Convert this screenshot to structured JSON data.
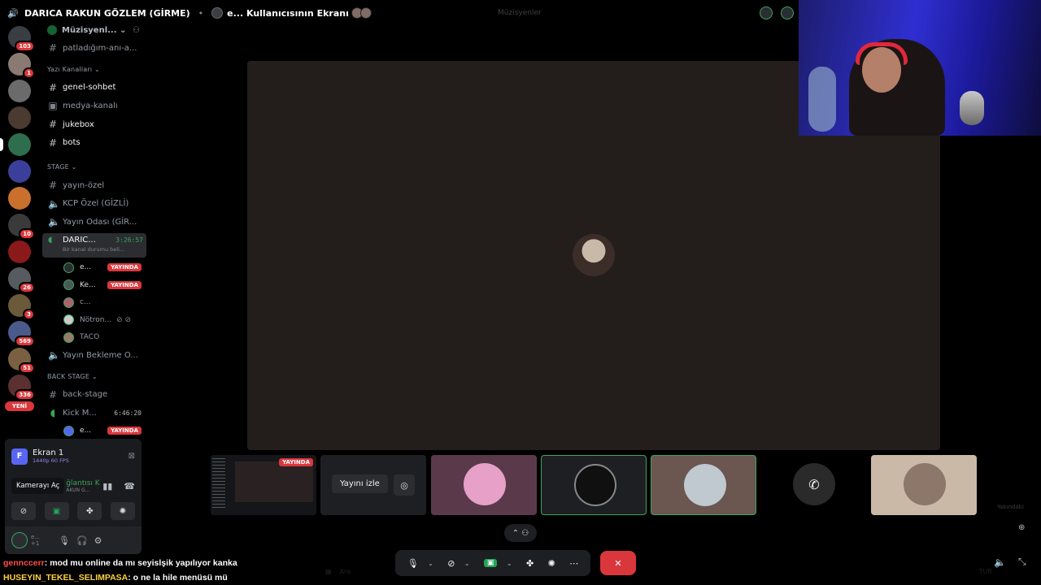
{
  "topbar": {
    "channel_title": "DARICA RAKUN GÖZLEM (GİRME)",
    "stream_title": "e... Kullanıcısının Ekranı",
    "ghost_label": "Müzisyenler"
  },
  "rail": {
    "servers": [
      {
        "badge": "103",
        "color": "#3a3d42"
      },
      {
        "badge": "1",
        "color": "#8a7a72"
      },
      {
        "badge": "",
        "color": "#6b6b6b"
      },
      {
        "badge": "",
        "color": "#4a3a30"
      },
      {
        "badge": "",
        "color": "#2e6e4e",
        "selected": true
      },
      {
        "badge": "",
        "color": "#3b3f99"
      },
      {
        "badge": "",
        "color": "#c9702c"
      },
      {
        "badge": "10",
        "color": "#3a3a3a"
      },
      {
        "badge": "",
        "color": "#8a1a1a"
      },
      {
        "badge": "26",
        "color": "#555b5f"
      },
      {
        "badge": "3",
        "color": "#6a5a3a"
      },
      {
        "badge": "569",
        "color": "#4a5a8a"
      },
      {
        "badge": "51",
        "color": "#7a6040"
      },
      {
        "badge": "336",
        "color": "#5a3030"
      }
    ],
    "new_label": "YENİ"
  },
  "channels": {
    "server_name": "Müzisyenl...",
    "top_channel": "patladığım-anı-a...",
    "cat_text": "Yazı Kanalları",
    "text_channels": [
      "genel-sohbet",
      "medya-kanalı",
      "jukebox",
      "bots"
    ],
    "cat_stage": "STAGE",
    "stage_channels": [
      "yayın-özel",
      "KCP Özel (GİZLİ)",
      "Yayın Odası (GİR..."
    ],
    "active_voice": {
      "name": "DARIC...",
      "time": "3:26:57",
      "status": "Bir kanal durumu beli..."
    },
    "members": [
      {
        "name": "e...",
        "live": "YAYINDA",
        "color": "#2a2d31"
      },
      {
        "name": "Ke...",
        "live": "YAYINDA",
        "color": "#4a5a5a"
      },
      {
        "name": "c...",
        "live": "",
        "color": "#b06070"
      },
      {
        "name": "Nötron...",
        "live": "",
        "color": "#cccccc",
        "muted": true
      },
      {
        "name": "TACO",
        "live": "",
        "color": "#9a7a6a"
      }
    ],
    "waiting_channel": "Yayın Bekleme O...",
    "cat_back": "BACK STAGE",
    "back_channel": "back-stage",
    "kick_channel": {
      "name": "Kick M...",
      "time": "6:46:20"
    },
    "kick_member": {
      "name": "e...",
      "live": "YAYINDA"
    }
  },
  "panel": {
    "screen_name": "Ekran 1",
    "screen_quality": "1440p 60 FPS",
    "tooltip": "Kamerayı Aç",
    "conn_status": "ğlantısı K",
    "conn_sub": "AKUN G...",
    "user_name": "e...",
    "user_sub": "+1"
  },
  "strip": {
    "live_label": "YAYINDA",
    "watch_label": "Yayını izle",
    "faint_label": "Yakındaki"
  },
  "chat": [
    {
      "user": "gennccerr",
      "text": ": mod mu online da mı seyislşik yapılıyor kanka"
    },
    {
      "user": "HUSEYIN_TEKEL_SELIMPASA",
      "text": ": o ne la hile menüsü mü"
    }
  ],
  "taskbar": {
    "search": "Ara",
    "lang": "TUR"
  },
  "colors": {
    "live_red": "#da373c",
    "online_green": "#23a559",
    "stage_bg": "#231e1c"
  }
}
